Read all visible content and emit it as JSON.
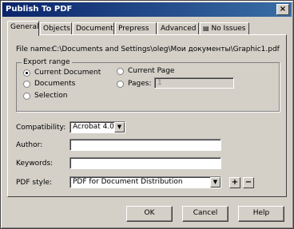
{
  "window": {
    "title": "Publish To PDF",
    "close_glyph": "×"
  },
  "tabs": [
    {
      "label": "General"
    },
    {
      "label": "Objects"
    },
    {
      "label": "Document"
    },
    {
      "label": "Prepress"
    },
    {
      "label": "Advanced"
    },
    {
      "label": "No Issues"
    }
  ],
  "general": {
    "file_name_label": "File name:",
    "file_name_value": "C:\\Documents and Settings\\oleg\\Мои документы\\Graphic1.pdf",
    "export_range": {
      "title": "Export range",
      "options": [
        {
          "label": "Current Document",
          "selected": true
        },
        {
          "label": "Documents",
          "selected": false
        },
        {
          "label": "Selection",
          "selected": false
        },
        {
          "label": "Current Page",
          "selected": false
        },
        {
          "label": "Pages:",
          "selected": false
        }
      ],
      "pages_value": "1"
    },
    "compatibility_label": "Compatibility:",
    "compatibility_value": "Acrobat 4.0",
    "author_label": "Author:",
    "author_value": "",
    "keywords_label": "Keywords:",
    "keywords_value": "",
    "pdf_style_label": "PDF style:",
    "pdf_style_value": "PDF for Document Distribution",
    "add_glyph": "+",
    "remove_glyph": "−"
  },
  "buttons": {
    "ok": "OK",
    "cancel": "Cancel",
    "help": "Help"
  }
}
